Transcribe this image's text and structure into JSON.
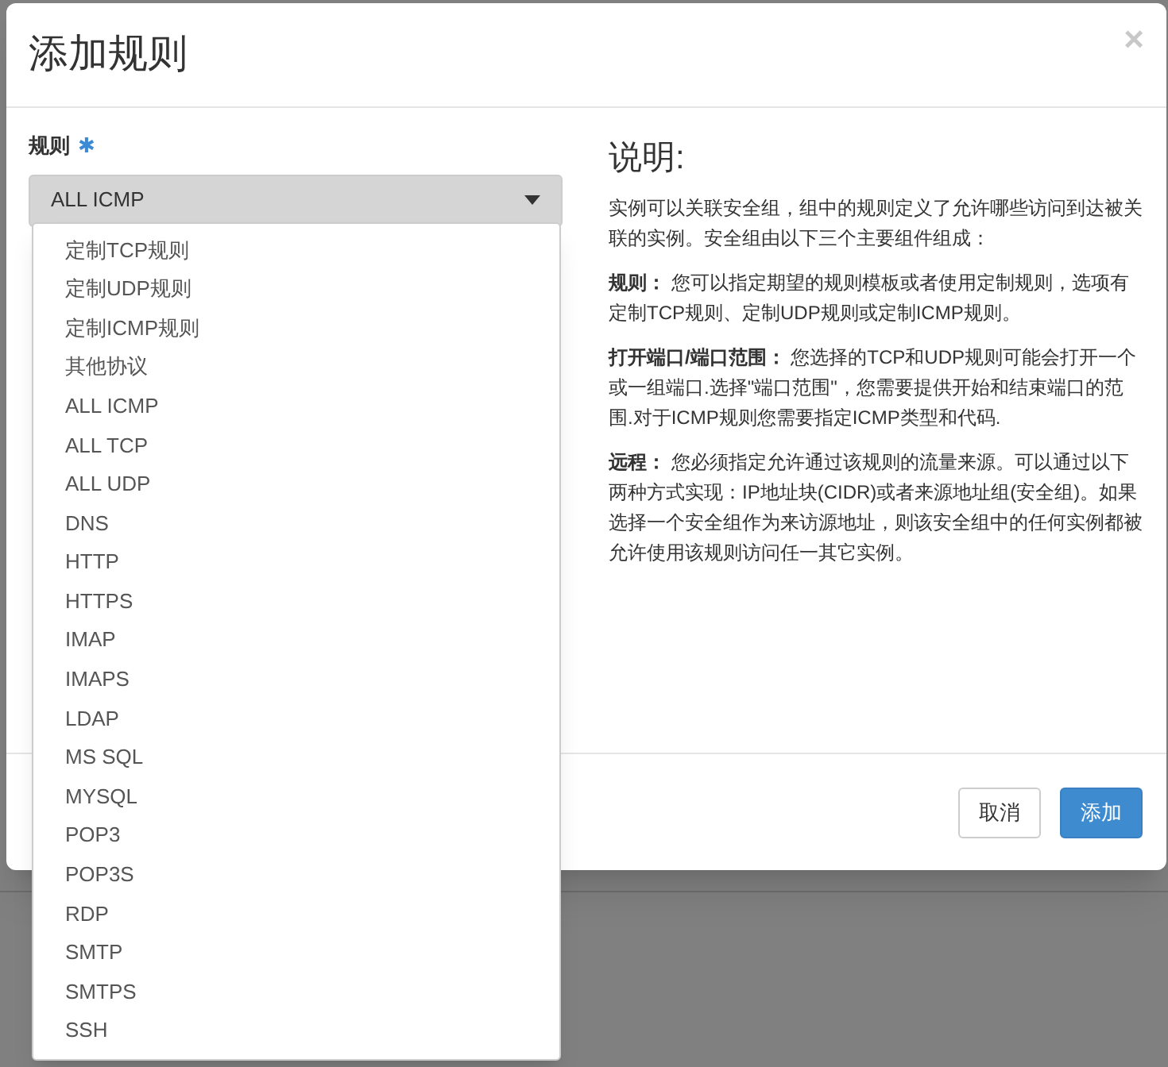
{
  "dialog": {
    "title": "添加规则",
    "close": "×"
  },
  "form": {
    "label": "规则",
    "required_mark": "✱",
    "select": {
      "value": "ALL ICMP",
      "expanded": true
    },
    "options": [
      {
        "label": "定制TCP规则",
        "selected": false
      },
      {
        "label": "定制UDP规则",
        "selected": false
      },
      {
        "label": "定制ICMP规则",
        "selected": false
      },
      {
        "label": "其他协议",
        "selected": false
      },
      {
        "label": "ALL ICMP",
        "selected": false
      },
      {
        "label": "ALL TCP",
        "selected": false
      },
      {
        "label": "ALL UDP",
        "selected": false
      },
      {
        "label": "DNS",
        "selected": false
      },
      {
        "label": "HTTP",
        "selected": false
      },
      {
        "label": "HTTPS",
        "selected": false
      },
      {
        "label": "IMAP",
        "selected": false
      },
      {
        "label": "IMAPS",
        "selected": false
      },
      {
        "label": "LDAP",
        "selected": false
      },
      {
        "label": "MS SQL",
        "selected": false
      },
      {
        "label": "MYSQL",
        "selected": false
      },
      {
        "label": "POP3",
        "selected": false
      },
      {
        "label": "POP3S",
        "selected": false
      },
      {
        "label": "RDP",
        "selected": false
      },
      {
        "label": "SMTP",
        "selected": false
      },
      {
        "label": "SMTPS",
        "selected": false
      },
      {
        "label": "SSH",
        "selected": false
      }
    ]
  },
  "help": {
    "title": "说明:",
    "paragraphs": [
      "实例可以关联安全组，组中的规则定义了允许哪些访问到达被关联的实例。安全组由以下三个主要组件组成：",
      "**规则：** 您可以指定期望的规则模板或者使用定制规则，选项有定制TCP规则、定制UDP规则或定制ICMP规则。",
      "**打开端口/端口范围：** 您选择的TCP和UDP规则可能会打开一个或一组端口.选择\"端口范围\"，您需要提供开始和结束端口的范围.对于ICMP规则您需要指定ICMP类型和代码.",
      "**远程：** 您必须指定允许通过该规则的流量来源。可以通过以下两种方式实现：IP地址块(CIDR)或者来源地址组(安全组)。如果选择一个安全组作为来访源地址，则该安全组中的任何实例都被允许使用该规则访问任一其它实例。"
    ]
  },
  "buttons": [
    {
      "label": "取消",
      "kind": "default"
    },
    {
      "label": "添加",
      "kind": "primary"
    }
  ]
}
